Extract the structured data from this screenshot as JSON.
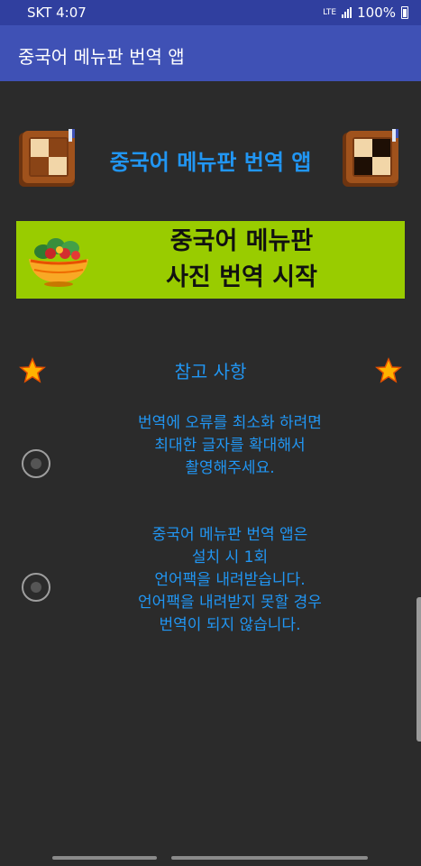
{
  "status_bar": {
    "carrier_time": "SKT 4:07",
    "network": "LTE",
    "battery": "100%"
  },
  "app_bar": {
    "title": "중국어 메뉴판 번역 앱"
  },
  "header": {
    "title": "중국어 메뉴판 번역 앱",
    "icon": "book-icon"
  },
  "start_banner": {
    "line1": "중국어 메뉴판",
    "line2": "사진 번역 시작",
    "icon": "salad-icon"
  },
  "notes": {
    "title": "참고 사항",
    "items": [
      {
        "lines": [
          "번역에 오류를 최소화 하려면",
          "최대한 글자를 확대해서",
          "촬영해주세요."
        ]
      },
      {
        "lines": [
          "중국어 메뉴판 번역 앱은",
          "설치 시 1회",
          "언어팩을 내려받습니다.",
          "언어팩을 내려받지 못할 경우",
          "번역이 되지 않습니다."
        ]
      }
    ]
  },
  "colors": {
    "app_bar": "#3f51b5",
    "status_bar": "#303f9f",
    "accent_text": "#2196f3",
    "banner": "#99cc00",
    "background": "#2b2b2b"
  }
}
